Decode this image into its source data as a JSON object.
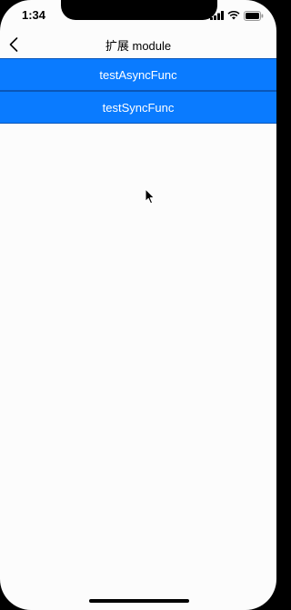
{
  "status_bar": {
    "time": "1:34",
    "icons": [
      "signal-icon",
      "wifi-icon",
      "battery-icon"
    ]
  },
  "nav": {
    "back_icon": "chevron-left-icon",
    "title": "扩展 module"
  },
  "actions": [
    {
      "label": "testAsyncFunc"
    },
    {
      "label": "testSyncFunc"
    }
  ],
  "colors": {
    "button_background": "#0a7bff",
    "button_text": "#ffffff",
    "screen_background": "#fcfcfc"
  }
}
